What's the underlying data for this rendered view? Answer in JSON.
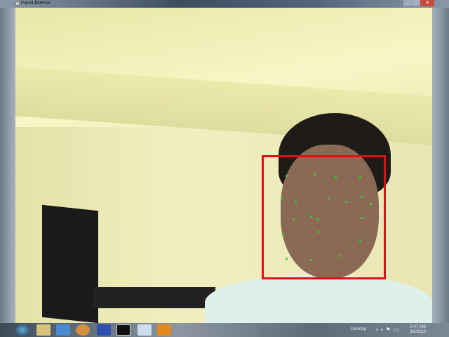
{
  "window": {
    "title": "FaceLkDemo",
    "minimize": "–",
    "maximize": "□",
    "close": "✕"
  },
  "overlay": {
    "face_box_color": "#e01010",
    "landmark_color": "#20e020",
    "landmark_count": 20
  },
  "taskbar": {
    "apps": [
      "Windows Explorer",
      "Internet Explorer",
      "Media Player",
      "Network",
      "Command Prompt",
      "Notepad",
      "VLC"
    ],
    "desktop_label": "Desktop",
    "time": "2:47 AM",
    "date": "3/6/2012"
  }
}
